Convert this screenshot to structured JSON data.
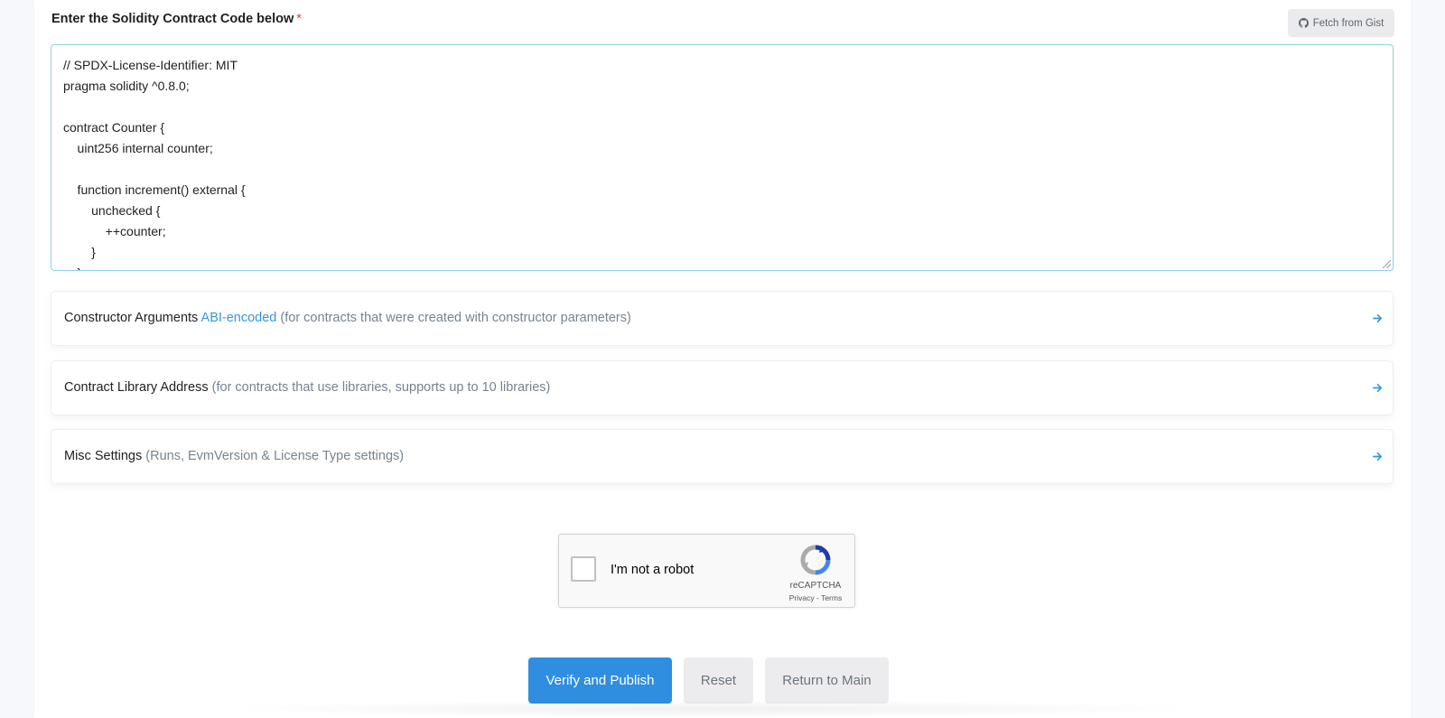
{
  "section": {
    "title": "Enter the Solidity Contract Code below",
    "required_mark": "*"
  },
  "gist_button": {
    "label": "Fetch from Gist",
    "icon": "github-icon"
  },
  "code": {
    "value": "// SPDX-License-Identifier: MIT\npragma solidity ^0.8.0;\n\ncontract Counter {\n    uint256 internal counter;\n\n    function increment() external {\n        unchecked {\n            ++counter;\n        }\n    }"
  },
  "accordions": [
    {
      "label": "Constructor Arguments",
      "link": "ABI-encoded",
      "hint": "(for contracts that were created with constructor parameters)",
      "icon": "arrow-right-icon"
    },
    {
      "label": "Contract Library Address",
      "hint": "(for contracts that use libraries, supports up to 10 libraries)",
      "icon": "arrow-right-icon"
    },
    {
      "label": "Misc Settings",
      "hint": "(Runs, EvmVersion & License Type settings)",
      "icon": "arrow-right-icon"
    }
  ],
  "captcha": {
    "label": "I'm not a robot",
    "brand": "reCAPTCHA",
    "privacy": "Privacy",
    "separator": "-",
    "terms": "Terms"
  },
  "actions": {
    "verify": "Verify and Publish",
    "reset": "Reset",
    "return": "Return to Main"
  },
  "colors": {
    "primary": "#2f8ee0",
    "link": "#3498db",
    "required": "#de4437",
    "muted": "#77838f"
  }
}
